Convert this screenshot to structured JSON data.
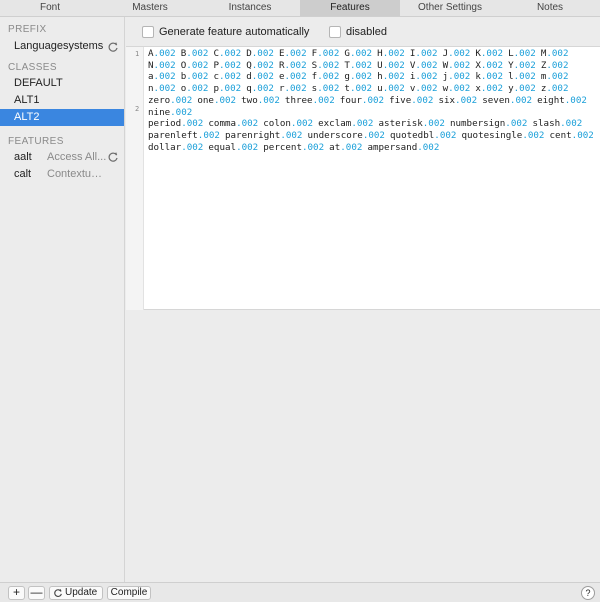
{
  "tabs": [
    {
      "label": "Font"
    },
    {
      "label": "Masters"
    },
    {
      "label": "Instances"
    },
    {
      "label": "Features"
    },
    {
      "label": "Other Settings"
    },
    {
      "label": "Notes"
    }
  ],
  "active_tab": "Features",
  "sidebar": {
    "prefix": {
      "heading": "PREFIX",
      "items": [
        {
          "label": "Languagesystems",
          "icon": "refresh-icon"
        }
      ]
    },
    "classes": {
      "heading": "CLASSES",
      "items": [
        {
          "label": "DEFAULT"
        },
        {
          "label": "ALT1"
        },
        {
          "label": "ALT2"
        }
      ],
      "selected": "ALT2"
    },
    "features": {
      "heading": "FEATURES",
      "items": [
        {
          "tag": "aalt",
          "note": "Access All...",
          "icon": "refresh-icon"
        },
        {
          "tag": "calt",
          "note": "Contextual..."
        }
      ]
    }
  },
  "options": {
    "generate_label": "Generate feature automatically",
    "generate_checked": false,
    "disabled_label": "disabled",
    "disabled_checked": false
  },
  "editor": {
    "suffix": ".002",
    "lines": [
      {
        "number": "1",
        "glyphs": [
          "A",
          "B",
          "C",
          "D",
          "E",
          "F",
          "G",
          "H",
          "I",
          "J",
          "K",
          "L",
          "M",
          "N",
          "O",
          "P",
          "Q",
          "R",
          "S",
          "T",
          "U",
          "V",
          "W",
          "X",
          "Y",
          "Z",
          "a",
          "b",
          "c",
          "d",
          "e",
          "f",
          "g",
          "h",
          "i",
          "j",
          "k",
          "l",
          "m",
          "n",
          "o",
          "p",
          "q",
          "r",
          "s",
          "t",
          "u",
          "v",
          "w",
          "x",
          "y",
          "z",
          "zero",
          "one",
          "two",
          "three",
          "four",
          "five",
          "six",
          "seven",
          "eight",
          "nine"
        ]
      },
      {
        "number": "2",
        "glyphs": [
          "period",
          "comma",
          "colon",
          "exclam",
          "asterisk",
          "numbersign",
          "slash",
          "parenleft",
          "parenright",
          "underscore",
          "quotedbl",
          "quotesingle",
          "cent",
          "dollar",
          "equal",
          "percent",
          "at",
          "ampersand"
        ]
      }
    ]
  },
  "bottom_bar": {
    "add_label": "+",
    "remove_label": "—",
    "update_label": "Update",
    "compile_label": "Compile",
    "help_label": "?"
  },
  "colors": {
    "selection": "#3a86e0",
    "suffix": "#1a9fd9",
    "section_heading": "#8a8a8a"
  }
}
